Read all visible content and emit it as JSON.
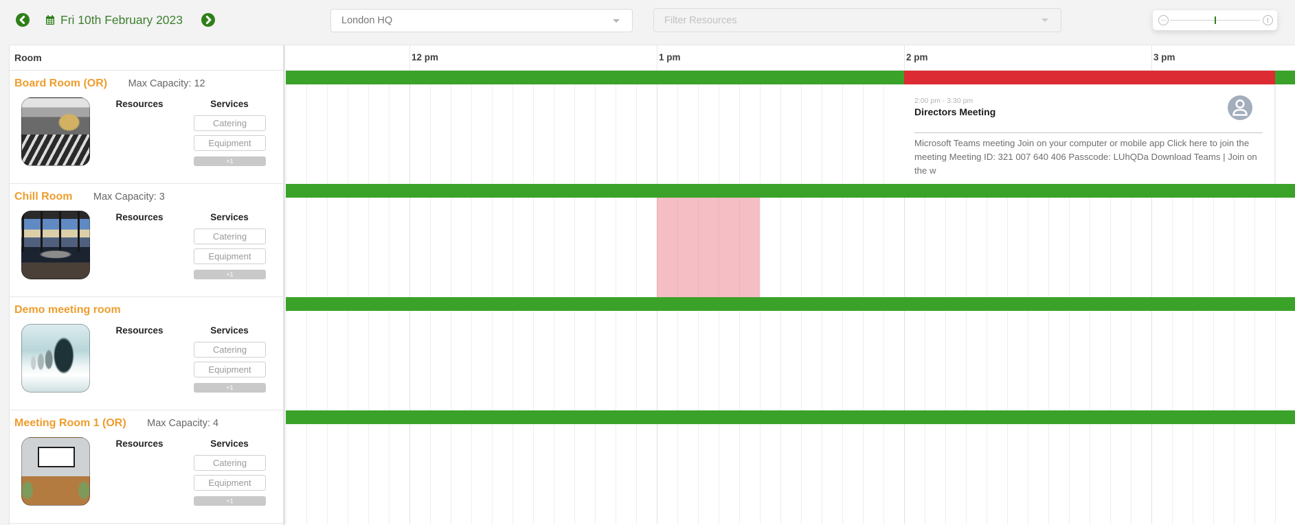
{
  "toolbar": {
    "prev_day_icon": "chevron-left-circle-icon",
    "calendar_icon": "calendar-icon",
    "date_label": "Fri 10th February 2023",
    "next_day_icon": "chevron-right-circle-icon",
    "location_select": {
      "value": "London HQ",
      "caret_icon": "caret-down-icon"
    },
    "resource_filter": {
      "placeholder": "Filter Resources",
      "value": "",
      "caret_icon": "caret-down-icon"
    },
    "zoom_slider": {
      "value": 0.5,
      "zoom_out_icon": "zoom-out-icon",
      "zoom_in_icon": "zoom-in-icon"
    }
  },
  "colors": {
    "accent": "#2f7f19",
    "room_name": "#ee9d2d",
    "available": "#3ba229",
    "booked": "#dc2b33",
    "unavailable": "rgba(230,110,125,0.45)",
    "avatar": "#a3adbb"
  },
  "scheduler": {
    "room_column_header": "Room",
    "timeline": {
      "start": "11:30",
      "end": "15:35",
      "slot_minutes": 5,
      "hour_labels": [
        {
          "time": "12:00",
          "label": "12 pm"
        },
        {
          "time": "13:00",
          "label": "1 pm"
        },
        {
          "time": "14:00",
          "label": "2 pm"
        },
        {
          "time": "15:00",
          "label": "3 pm"
        }
      ]
    },
    "rooms": [
      {
        "name": "Board Room (OR)",
        "capacity_label": "Max Capacity: 12",
        "resources_label": "Resources",
        "services_label": "Services",
        "services": [
          "Catering",
          "Equipment"
        ],
        "more_services_label": "+1",
        "availability": [
          {
            "start": "11:30",
            "end": "14:00",
            "status": "available"
          },
          {
            "start": "14:00",
            "end": "15:30",
            "status": "booked"
          },
          {
            "start": "15:30",
            "end": "15:35",
            "status": "available"
          }
        ],
        "bookings": [
          {
            "start": "14:00",
            "end": "15:30",
            "time_label": "2:00 pm - 3:30 pm",
            "title": "Directors Meeting",
            "organizer_icon": "user-avatar-icon",
            "description": "Microsoft Teams meeting Join on your computer or mobile app Click here to join the meeting Meeting ID: 321 007 640 406 Passcode: LUhQDa Download Teams | Join on the w"
          }
        ]
      },
      {
        "name": "Chill Room",
        "capacity_label": "Max Capacity: 3",
        "resources_label": "Resources",
        "services_label": "Services",
        "services": [
          "Catering",
          "Equipment"
        ],
        "more_services_label": "+1",
        "availability": [
          {
            "start": "11:30",
            "end": "15:35",
            "status": "available"
          }
        ],
        "unavailable": [
          {
            "start": "13:00",
            "end": "13:25"
          }
        ]
      },
      {
        "name": "Demo meeting room",
        "resources_label": "Resources",
        "services_label": "Services",
        "services": [
          "Catering",
          "Equipment"
        ],
        "more_services_label": "+1",
        "availability": [
          {
            "start": "11:30",
            "end": "15:35",
            "status": "available"
          }
        ]
      },
      {
        "name": "Meeting Room 1 (OR)",
        "capacity_label": "Max Capacity: 4",
        "resources_label": "Resources",
        "services_label": "Services",
        "services": [
          "Catering",
          "Equipment"
        ],
        "more_services_label": "+1",
        "availability": [
          {
            "start": "11:30",
            "end": "15:35",
            "status": "available"
          }
        ]
      }
    ]
  }
}
